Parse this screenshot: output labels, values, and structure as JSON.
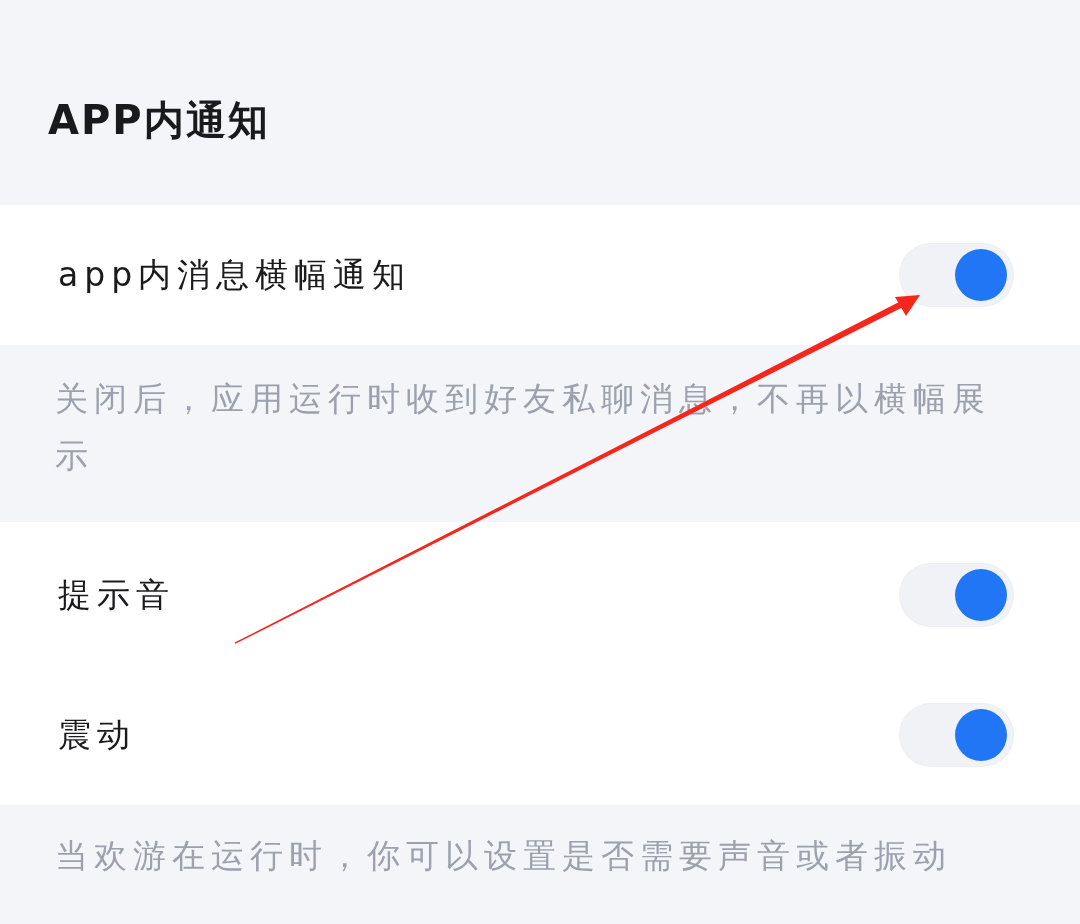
{
  "header": {
    "title": "APP内通知"
  },
  "sections": [
    {
      "items": [
        {
          "label": "app内消息横幅通知",
          "on": true
        }
      ],
      "footnote": "关闭后，应用运行时收到好友私聊消息，不再以横幅展示"
    },
    {
      "items": [
        {
          "label": "提示音",
          "on": true
        },
        {
          "label": "震动",
          "on": true
        }
      ],
      "footnote": "当欢游在运行时，你可以设置是否需要声音或者振动"
    }
  ]
}
